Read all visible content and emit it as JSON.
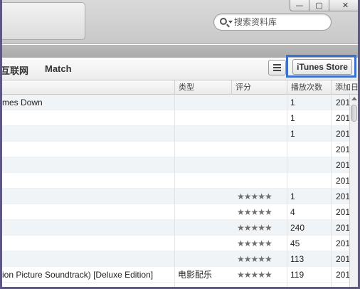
{
  "search": {
    "placeholder": "搜索资料库"
  },
  "window_controls": {
    "minimize": "—",
    "restore": "▢",
    "close": "✕"
  },
  "nav": {
    "internet_tab": "互联网",
    "match_tab": "Match",
    "store_button": "iTunes Store"
  },
  "columns": {
    "genre": "类型",
    "rating": "评分",
    "plays": "播放次数",
    "added": "添加日"
  },
  "rows": [
    {
      "name": "mes Down",
      "genre": "",
      "rating": "",
      "plays": "1",
      "added": "201"
    },
    {
      "name": "",
      "genre": "",
      "rating": "",
      "plays": "1",
      "added": "201"
    },
    {
      "name": "",
      "genre": "",
      "rating": "",
      "plays": "1",
      "added": "201"
    },
    {
      "name": "",
      "genre": "",
      "rating": "",
      "plays": "",
      "added": "201"
    },
    {
      "name": "",
      "genre": "",
      "rating": "",
      "plays": "",
      "added": "201"
    },
    {
      "name": "",
      "genre": "",
      "rating": "",
      "plays": "",
      "added": "201"
    },
    {
      "name": "",
      "genre": "",
      "rating": "★★★★★",
      "plays": "1",
      "added": "201"
    },
    {
      "name": "",
      "genre": "",
      "rating": "★★★★★",
      "plays": "4",
      "added": "201"
    },
    {
      "name": "",
      "genre": "",
      "rating": "★★★★★",
      "plays": "240",
      "added": "201"
    },
    {
      "name": "",
      "genre": "",
      "rating": "★★★★★",
      "plays": "45",
      "added": "201"
    },
    {
      "name": "",
      "genre": "",
      "rating": "★★★★★",
      "plays": "113",
      "added": "201"
    },
    {
      "name": "ion Picture Soundtrack) [Deluxe Edition]",
      "genre": "电影配乐",
      "rating": "★★★★★",
      "plays": "119",
      "added": "201"
    }
  ]
}
